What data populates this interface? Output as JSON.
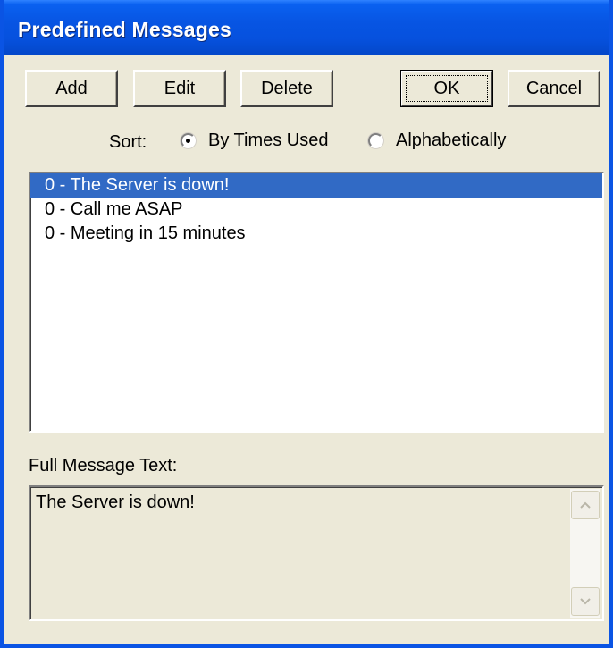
{
  "window": {
    "title": "Predefined Messages"
  },
  "toolbar": {
    "add_label": "Add",
    "edit_label": "Edit",
    "delete_label": "Delete",
    "ok_label": "OK",
    "cancel_label": "Cancel"
  },
  "sort": {
    "label": "Sort:",
    "options": [
      {
        "label": "By Times Used",
        "selected": true
      },
      {
        "label": "Alphabetically",
        "selected": false
      }
    ]
  },
  "messages": {
    "items": [
      {
        "text": "0 - The Server is down!",
        "selected": true
      },
      {
        "text": "0 - Call me ASAP",
        "selected": false
      },
      {
        "text": "0 - Meeting in 15 minutes",
        "selected": false
      }
    ]
  },
  "full_message": {
    "label": "Full Message Text:",
    "value": "The Server is down!"
  },
  "colors": {
    "titlebar": "#0755e3",
    "dialog_bg": "#ece9d8",
    "selection": "#316ac5"
  },
  "icons": {
    "scroll_up": "chevron-up-icon",
    "scroll_down": "chevron-down-icon"
  }
}
